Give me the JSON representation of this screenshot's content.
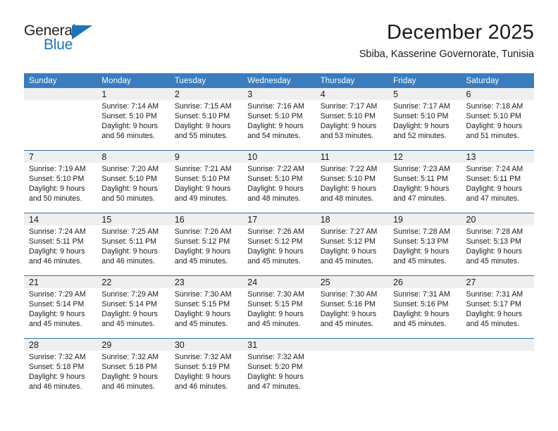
{
  "brand": {
    "name_top": "General",
    "name_bottom": "Blue",
    "top_color": "#231f20",
    "bottom_color": "#1b75bb",
    "triangle_icon": "triangle-icon"
  },
  "header": {
    "title": "December 2025",
    "subtitle": "Sbiba, Kasserine Governorate, Tunisia"
  },
  "theme": {
    "header_blue": "#3a7cbd",
    "row_rule_blue": "#2f6fae",
    "daynum_band": "#efefef",
    "text": "#1a1a1a"
  },
  "calendar": {
    "weekday_headers": [
      "Sunday",
      "Monday",
      "Tuesday",
      "Wednesday",
      "Thursday",
      "Friday",
      "Saturday"
    ],
    "weeks": [
      [
        {
          "day": "",
          "detail": ""
        },
        {
          "day": "1",
          "detail": "Sunrise: 7:14 AM\nSunset: 5:10 PM\nDaylight: 9 hours\nand 56 minutes."
        },
        {
          "day": "2",
          "detail": "Sunrise: 7:15 AM\nSunset: 5:10 PM\nDaylight: 9 hours\nand 55 minutes."
        },
        {
          "day": "3",
          "detail": "Sunrise: 7:16 AM\nSunset: 5:10 PM\nDaylight: 9 hours\nand 54 minutes."
        },
        {
          "day": "4",
          "detail": "Sunrise: 7:17 AM\nSunset: 5:10 PM\nDaylight: 9 hours\nand 53 minutes."
        },
        {
          "day": "5",
          "detail": "Sunrise: 7:17 AM\nSunset: 5:10 PM\nDaylight: 9 hours\nand 52 minutes."
        },
        {
          "day": "6",
          "detail": "Sunrise: 7:18 AM\nSunset: 5:10 PM\nDaylight: 9 hours\nand 51 minutes."
        }
      ],
      [
        {
          "day": "7",
          "detail": "Sunrise: 7:19 AM\nSunset: 5:10 PM\nDaylight: 9 hours\nand 50 minutes."
        },
        {
          "day": "8",
          "detail": "Sunrise: 7:20 AM\nSunset: 5:10 PM\nDaylight: 9 hours\nand 50 minutes."
        },
        {
          "day": "9",
          "detail": "Sunrise: 7:21 AM\nSunset: 5:10 PM\nDaylight: 9 hours\nand 49 minutes."
        },
        {
          "day": "10",
          "detail": "Sunrise: 7:22 AM\nSunset: 5:10 PM\nDaylight: 9 hours\nand 48 minutes."
        },
        {
          "day": "11",
          "detail": "Sunrise: 7:22 AM\nSunset: 5:10 PM\nDaylight: 9 hours\nand 48 minutes."
        },
        {
          "day": "12",
          "detail": "Sunrise: 7:23 AM\nSunset: 5:11 PM\nDaylight: 9 hours\nand 47 minutes."
        },
        {
          "day": "13",
          "detail": "Sunrise: 7:24 AM\nSunset: 5:11 PM\nDaylight: 9 hours\nand 47 minutes."
        }
      ],
      [
        {
          "day": "14",
          "detail": "Sunrise: 7:24 AM\nSunset: 5:11 PM\nDaylight: 9 hours\nand 46 minutes."
        },
        {
          "day": "15",
          "detail": "Sunrise: 7:25 AM\nSunset: 5:11 PM\nDaylight: 9 hours\nand 46 minutes."
        },
        {
          "day": "16",
          "detail": "Sunrise: 7:26 AM\nSunset: 5:12 PM\nDaylight: 9 hours\nand 45 minutes."
        },
        {
          "day": "17",
          "detail": "Sunrise: 7:26 AM\nSunset: 5:12 PM\nDaylight: 9 hours\nand 45 minutes."
        },
        {
          "day": "18",
          "detail": "Sunrise: 7:27 AM\nSunset: 5:12 PM\nDaylight: 9 hours\nand 45 minutes."
        },
        {
          "day": "19",
          "detail": "Sunrise: 7:28 AM\nSunset: 5:13 PM\nDaylight: 9 hours\nand 45 minutes."
        },
        {
          "day": "20",
          "detail": "Sunrise: 7:28 AM\nSunset: 5:13 PM\nDaylight: 9 hours\nand 45 minutes."
        }
      ],
      [
        {
          "day": "21",
          "detail": "Sunrise: 7:29 AM\nSunset: 5:14 PM\nDaylight: 9 hours\nand 45 minutes."
        },
        {
          "day": "22",
          "detail": "Sunrise: 7:29 AM\nSunset: 5:14 PM\nDaylight: 9 hours\nand 45 minutes."
        },
        {
          "day": "23",
          "detail": "Sunrise: 7:30 AM\nSunset: 5:15 PM\nDaylight: 9 hours\nand 45 minutes."
        },
        {
          "day": "24",
          "detail": "Sunrise: 7:30 AM\nSunset: 5:15 PM\nDaylight: 9 hours\nand 45 minutes."
        },
        {
          "day": "25",
          "detail": "Sunrise: 7:30 AM\nSunset: 5:16 PM\nDaylight: 9 hours\nand 45 minutes."
        },
        {
          "day": "26",
          "detail": "Sunrise: 7:31 AM\nSunset: 5:16 PM\nDaylight: 9 hours\nand 45 minutes."
        },
        {
          "day": "27",
          "detail": "Sunrise: 7:31 AM\nSunset: 5:17 PM\nDaylight: 9 hours\nand 45 minutes."
        }
      ],
      [
        {
          "day": "28",
          "detail": "Sunrise: 7:32 AM\nSunset: 5:18 PM\nDaylight: 9 hours\nand 46 minutes."
        },
        {
          "day": "29",
          "detail": "Sunrise: 7:32 AM\nSunset: 5:18 PM\nDaylight: 9 hours\nand 46 minutes."
        },
        {
          "day": "30",
          "detail": "Sunrise: 7:32 AM\nSunset: 5:19 PM\nDaylight: 9 hours\nand 46 minutes."
        },
        {
          "day": "31",
          "detail": "Sunrise: 7:32 AM\nSunset: 5:20 PM\nDaylight: 9 hours\nand 47 minutes."
        },
        {
          "day": "",
          "detail": ""
        },
        {
          "day": "",
          "detail": ""
        },
        {
          "day": "",
          "detail": ""
        }
      ]
    ]
  }
}
